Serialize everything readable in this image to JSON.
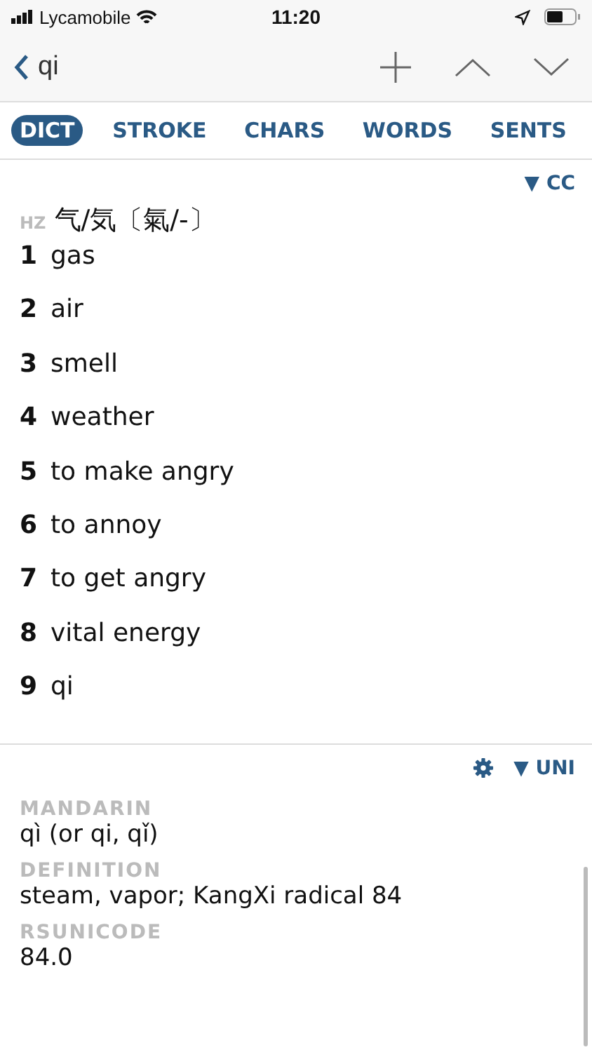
{
  "status_bar": {
    "carrier": "Lycamobile",
    "time": "11:20"
  },
  "nav": {
    "back_label": "qi"
  },
  "tabs": [
    {
      "label": "DICT",
      "selected": true
    },
    {
      "label": "STROKE",
      "selected": false
    },
    {
      "label": "CHARS",
      "selected": false
    },
    {
      "label": "WORDS",
      "selected": false
    },
    {
      "label": "SENTS",
      "selected": false
    }
  ],
  "dict": {
    "source_toggle": "▼ CC",
    "tag": "HZ",
    "headword": "气/気〔氣/-〕",
    "senses": [
      {
        "number": "1",
        "text": "gas"
      },
      {
        "number": "2",
        "text": "air"
      },
      {
        "number": "3",
        "text": "smell"
      },
      {
        "number": "4",
        "text": "weather"
      },
      {
        "number": "5",
        "text": "to make angry"
      },
      {
        "number": "6",
        "text": "to annoy"
      },
      {
        "number": "7",
        "text": "to get angry"
      },
      {
        "number": "8",
        "text": "vital energy"
      },
      {
        "number": "9",
        "text": "qi"
      }
    ]
  },
  "unihan": {
    "source_toggle": "▼ UNI",
    "fields": [
      {
        "label": "MANDARIN",
        "value": "qì (or qi, qǐ)"
      },
      {
        "label": "DEFINITION",
        "value": "steam, vapor; KangXi radical 84"
      },
      {
        "label": "RSUNICODE",
        "value": "84.0"
      }
    ]
  }
}
